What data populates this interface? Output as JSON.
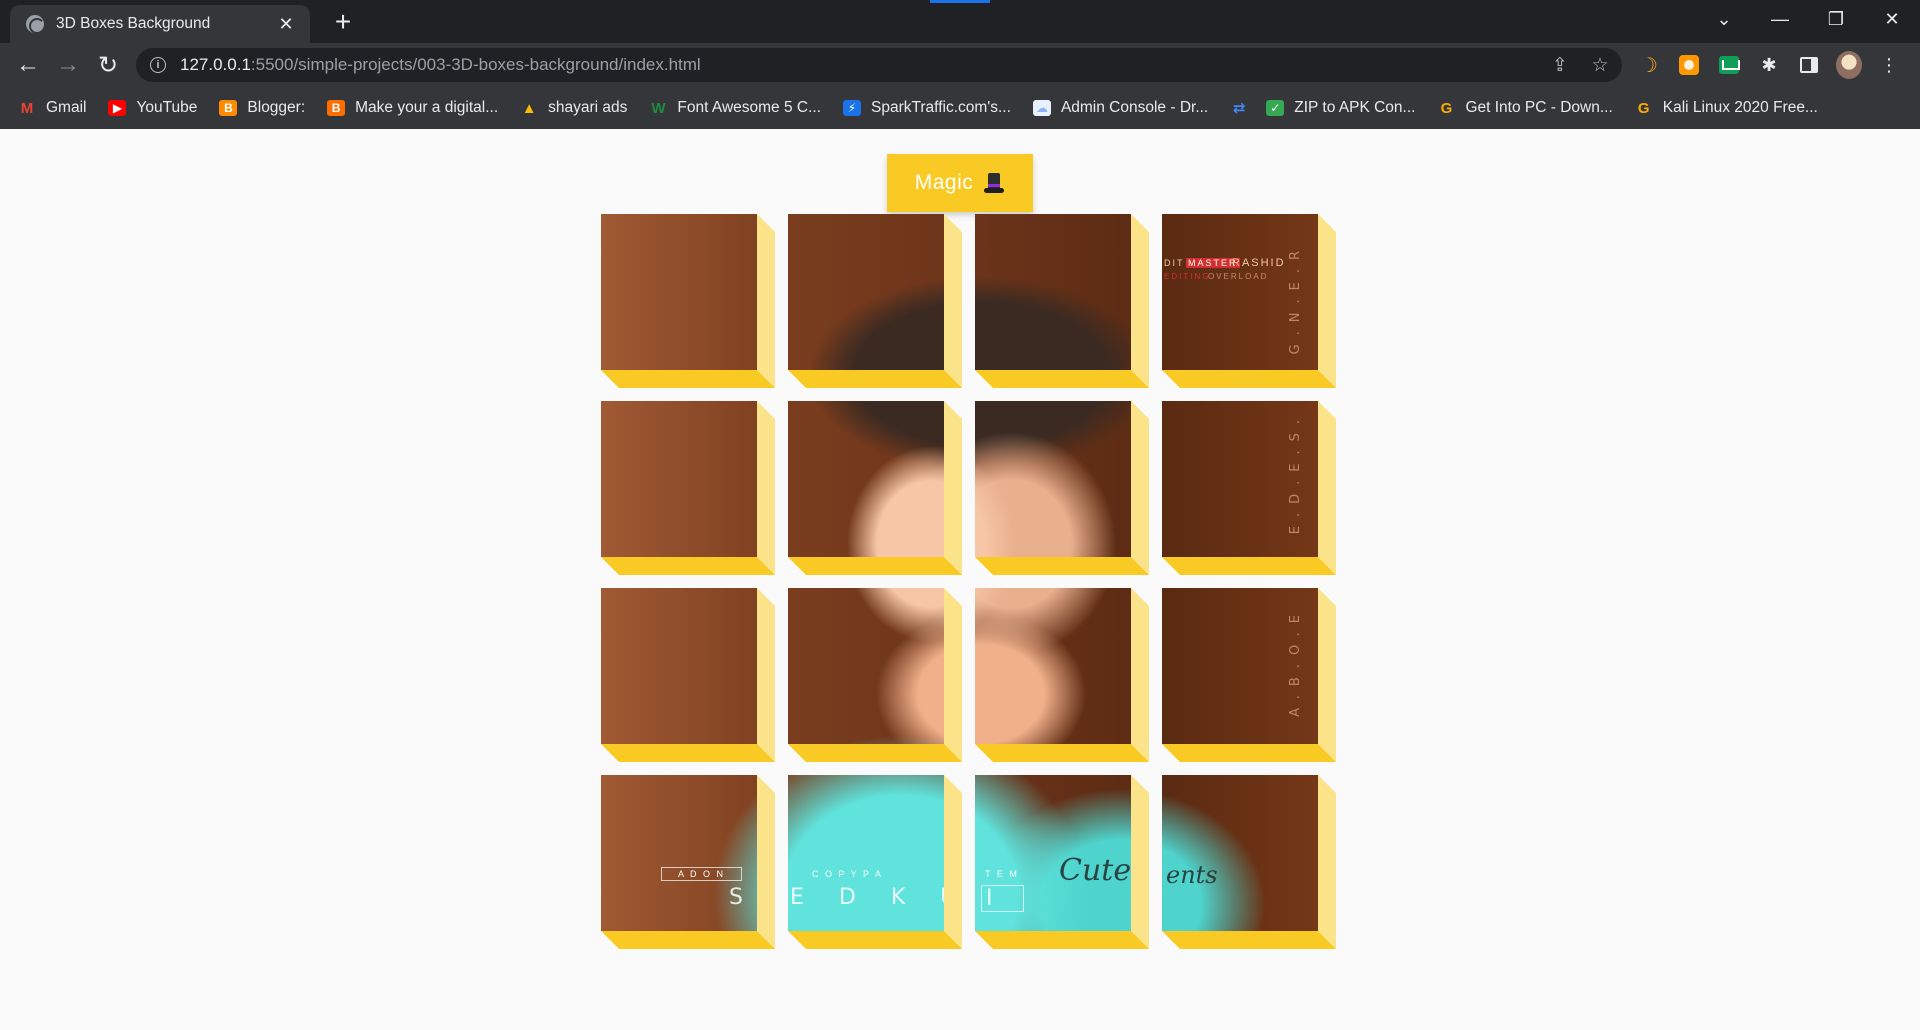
{
  "browser": {
    "tab_title": "3D Boxes Background",
    "url_host": "127.0.0.1",
    "url_path": ":5500/simple-projects/003-3D-boxes-background/index.html",
    "bookmarks": [
      {
        "label": "Gmail",
        "icon": "gmail-icon",
        "color": "#ea4335"
      },
      {
        "label": "YouTube",
        "icon": "youtube-icon",
        "color": "#ff0000"
      },
      {
        "label": "Blogger:",
        "icon": "blogger-icon",
        "color": "#ff8c00"
      },
      {
        "label": "Make your a digital...",
        "icon": "blogger-icon",
        "color": "#ff6d00"
      },
      {
        "label": "shayari ads",
        "icon": "google-ads-icon",
        "color": "#fbbc04"
      },
      {
        "label": "Font Awesome 5 C...",
        "icon": "w-icon",
        "color": "#1e8e3e"
      },
      {
        "label": "SparkTraffic.com's...",
        "icon": "bolt-icon",
        "color": "#1a73e8"
      },
      {
        "label": "Admin Console - Dr...",
        "icon": "cloud-icon",
        "color": "#e8f0fe"
      },
      {
        "label": "",
        "icon": "transfer-icon",
        "color": "#4285f4"
      },
      {
        "label": "ZIP to APK Con...",
        "icon": "checkbox-icon",
        "color": "#34a853"
      },
      {
        "label": "Get Into PC - Down...",
        "icon": "g-icon",
        "color": "#f9ab00"
      },
      {
        "label": "Kali Linux 2020 Free...",
        "icon": "g-icon",
        "color": "#f9ab00"
      }
    ]
  },
  "page": {
    "magic_label": "Magic",
    "overlays": {
      "credit_master": "MASTER",
      "credit_edit": "DIT",
      "credit_rashid": "RASHID",
      "credit_editing": "EDITING",
      "credit_overload": "OVERLOAD",
      "vertical_1": "G.N.E.R",
      "vertical_2": "E.D.E.S.",
      "vertical_3": "A.B.O.E",
      "footer_1": "A D O N",
      "footer_2": "C O P Y   P A",
      "footer_3": "T E   M",
      "name_1": "S",
      "name_2": "E D   K U R",
      "name_3": "I",
      "script_1": "Cute",
      "script_2": "ents"
    }
  },
  "colors": {
    "accent": "#f9ca24",
    "box_side": "#fbe38a",
    "page_bg": "#fafafa"
  }
}
